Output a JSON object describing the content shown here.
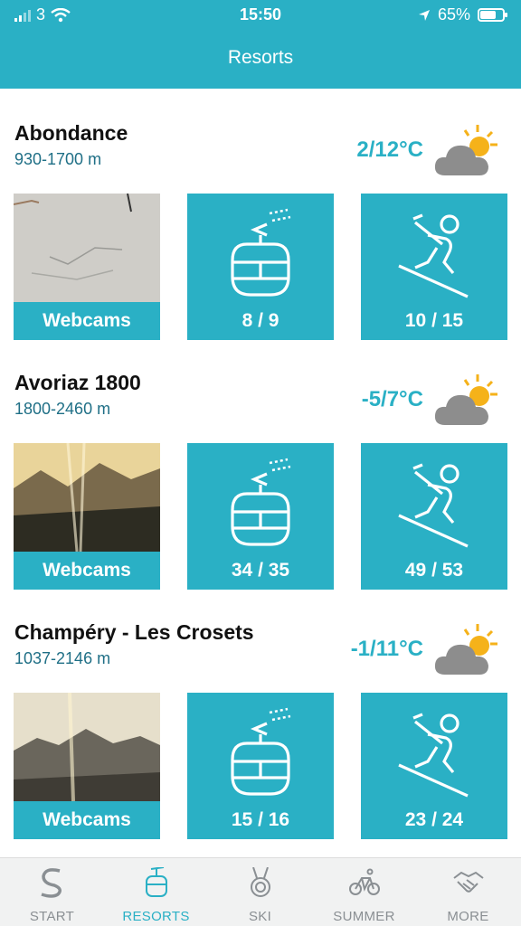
{
  "status_bar": {
    "carrier": "3",
    "time": "15:50",
    "battery": "65%"
  },
  "nav": {
    "title": "Resorts"
  },
  "colors": {
    "accent": "#2AB0C5",
    "altitude": "#1f6f86"
  },
  "resorts": [
    {
      "name": "Abondance",
      "altitude": "930-1700 m",
      "temperature": "2/12°C",
      "weather_icon": "sun-behind-cloud-icon",
      "webcam_label": "Webcams",
      "lifts": "8 / 9",
      "slopes": "10 / 15"
    },
    {
      "name": "Avoriaz 1800",
      "altitude": "1800-2460 m",
      "temperature": "-5/7°C",
      "weather_icon": "sun-behind-cloud-icon",
      "webcam_label": "Webcams",
      "lifts": "34 / 35",
      "slopes": "49 / 53"
    },
    {
      "name": "Champéry - Les Crosets",
      "altitude": "1037-2146 m",
      "temperature": "-1/11°C",
      "weather_icon": "sun-behind-cloud-icon",
      "webcam_label": "Webcams",
      "lifts": "15 / 16",
      "slopes": "23 / 24"
    }
  ],
  "tabs": [
    {
      "label": "START",
      "icon": "s-logo-icon",
      "active": false
    },
    {
      "label": "RESORTS",
      "icon": "gondola-icon",
      "active": true
    },
    {
      "label": "SKI",
      "icon": "medal-icon",
      "active": false
    },
    {
      "label": "SUMMER",
      "icon": "bike-icon",
      "active": false
    },
    {
      "label": "MORE",
      "icon": "handshake-icon",
      "active": false
    }
  ]
}
